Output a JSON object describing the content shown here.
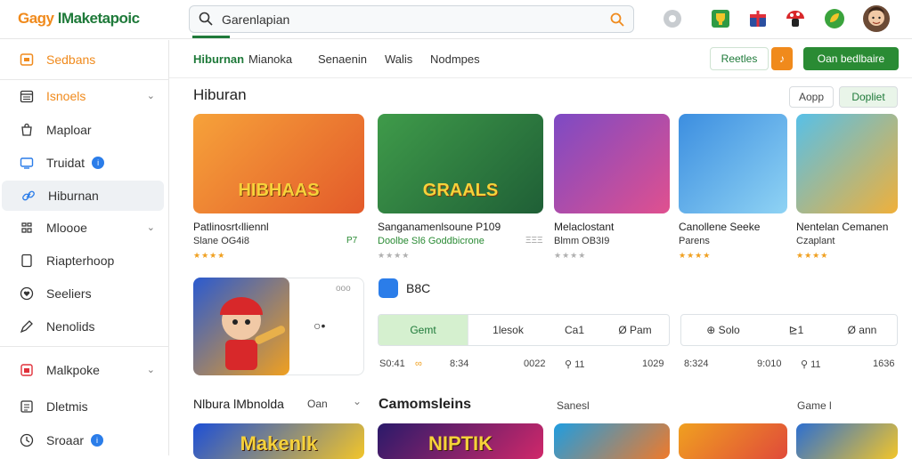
{
  "header": {
    "logo_part1": "Gagy",
    "logo_part2": "lMaketapoic",
    "search_placeholder": "Garenlapian",
    "icons": [
      "gear-icon",
      "trophy-icon",
      "gift-icon",
      "mushroom-icon",
      "leaf-icon",
      "avatar"
    ]
  },
  "sidebar": {
    "items": [
      {
        "label": "Sedbans",
        "icon": "store-icon"
      },
      {
        "label": "Isnoels",
        "icon": "calendar-icon"
      },
      {
        "label": "Maploar",
        "icon": "bag-icon"
      },
      {
        "label": "Truidat",
        "icon": "tv-icon",
        "badge": "i"
      },
      {
        "label": "Hiburnan",
        "icon": "link-icon"
      },
      {
        "label": "Mloooe",
        "icon": "game-icon"
      },
      {
        "label": "Riapterhoop",
        "icon": "doc-icon"
      },
      {
        "label": "Seeliers",
        "icon": "heart-icon"
      },
      {
        "label": "Nenolids",
        "icon": "pen-icon"
      },
      {
        "label": "Malkpoke",
        "icon": "shop-icon"
      },
      {
        "label": "Dletmis",
        "icon": "list-icon"
      },
      {
        "label": "Sroaar",
        "icon": "clock-icon",
        "badge": "i"
      }
    ]
  },
  "tabs": [
    "Hiburnan",
    "Mianoka",
    "Senaenin",
    "Walis",
    "Nodmpes"
  ],
  "actions": {
    "outline_btn": "Reetles",
    "primary_btn": "Oan bedlbaire"
  },
  "section1": {
    "title": "Hiburan",
    "btn_app": "Aopp",
    "btn_explore": "Dopliet",
    "cards": [
      {
        "title": "Patlinosrt‹lliennl",
        "sub": "Slane OG4i8",
        "badge": "P7",
        "stars": "★★★★",
        "art": "HIBHAAS",
        "colors": [
          "#f6a23a",
          "#e35a2a"
        ]
      },
      {
        "title": "Sanganamenlsoune P109",
        "sub": "Doolbe Sl6 Goddbicrone",
        "badge": "ΞΞΞ",
        "stars": "★★★★",
        "art": "GRAALS",
        "colors": [
          "#3f9b4a",
          "#1f5f36"
        ]
      },
      {
        "title": "Melaclostant",
        "sub": "Blmm OB3I9",
        "badge": "",
        "stars": "★★★★",
        "art": "",
        "colors": [
          "#7d4ac4",
          "#e0508f"
        ]
      },
      {
        "title": "Canollene Seeke",
        "sub": "Parens",
        "badge": "",
        "stars": "★★★★",
        "art": "",
        "colors": [
          "#3c8ee0",
          "#8fd3f4"
        ]
      },
      {
        "title": "Nentelan Cemanen",
        "sub": "Czaplant",
        "badge": "",
        "stars": "★★★★",
        "art": "",
        "colors": [
          "#57c0e8",
          "#f0b03a"
        ]
      }
    ]
  },
  "feature": {
    "label": "B8C",
    "more": "ooo",
    "play_glyph": "○•",
    "seg1": [
      "Gemt",
      "1lesok",
      "Ca1",
      "Ø Pam"
    ],
    "seg2": [
      "⊕ Solo",
      "⊵1",
      "Ø ann"
    ],
    "stats": [
      "S0:41",
      "∞",
      "8:34",
      "0022",
      "⚲ 11",
      "1029",
      "8:324",
      "9:010",
      "⚲ 11",
      "1636"
    ]
  },
  "section2": {
    "left_title": "Nlbura lMbnolda",
    "left_sub": "Oan",
    "mid_title": "Camomsleins",
    "mid_sub": "Sanesl",
    "right_sub": "Game l",
    "banners": [
      {
        "art": "Makenlk",
        "colors": [
          "#1d4fd6",
          "#f2c52a"
        ]
      },
      {
        "art": "NIPTIK",
        "colors": [
          "#2a1a6a",
          "#d0286a"
        ]
      },
      {
        "art": "",
        "colors": [
          "#1f9de0",
          "#f07a2a"
        ]
      },
      {
        "art": "",
        "colors": [
          "#f0a020",
          "#e04a3a"
        ]
      },
      {
        "art": "",
        "colors": [
          "#2d6fd0",
          "#f2c52a"
        ]
      }
    ]
  }
}
